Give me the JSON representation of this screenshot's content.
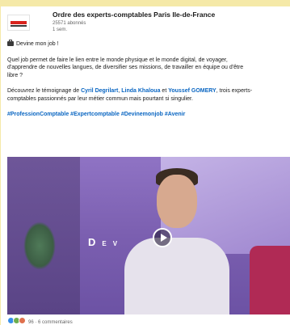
{
  "post": {
    "author": "Ordre des experts-comptables Paris Ile-de-France",
    "followers": "25571 abonnés",
    "time": "1 sem.",
    "headline": "Devine mon job !",
    "paragraph1_line1": "Quel job permet de faire le lien entre le monde physique et le monde digital, de voyager,",
    "paragraph1_line2": "d'apprendre de nouvelles langues, de diversifier ses missions, de travailler en équipe ou d'être",
    "paragraph1_line3": "libre ?",
    "paragraph2_line1_start": "Découvrez le témoignage de ",
    "person1": "Cyril Degrilart",
    "sep1": ", ",
    "person2": "Linda Khaloua",
    "sep2": " et ",
    "person3": "Youssef GOMERY",
    "paragraph2_line1_end": ", trois experts-",
    "paragraph2_line2": "comptables passionnés par leur métier commun mais pourtant si singulier.",
    "hashtags": "#ProfessionComptable #Expertcomptable #Devinemonjob #Avenir"
  },
  "video": {
    "letter_d": "D",
    "letter_e": "E",
    "letter_v": "V"
  },
  "reactions": {
    "count": "96",
    "comments": "· 6 commentaires"
  },
  "colors": {
    "link": "#0a66c2",
    "page_bg": "#f5e9a8",
    "video_tint": "#7b5fb0"
  }
}
